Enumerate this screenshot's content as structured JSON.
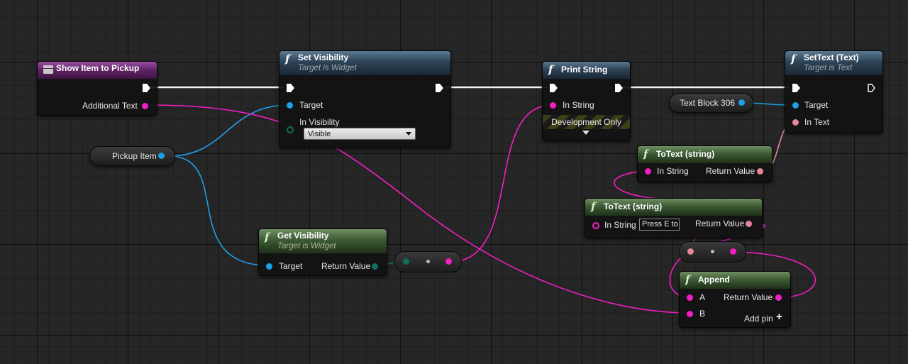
{
  "colors": {
    "exec": "#ffffff",
    "object_pin": "#1e9fe6",
    "string_pin": "#f21ec4",
    "text_pin": "#e6889c",
    "bool_pin": "#0f6f5e",
    "function_header": "#2e4356",
    "pure_header": "#3c5a34",
    "event_header": "#5e2262"
  },
  "nodes": {
    "show_item": {
      "title": "Show Item to Pickup",
      "icon": "event-icon",
      "pin_additional_text": "Additional Text"
    },
    "set_visibility": {
      "title": "Set Visibility",
      "subtitle": "Target is Widget",
      "pin_target": "Target",
      "pin_in_visibility": "In Visibility",
      "in_visibility_value": "Visible"
    },
    "print_string": {
      "title": "Print String",
      "pin_in_string": "In String",
      "dev_only": "Development Only"
    },
    "set_text": {
      "title": "SetText (Text)",
      "subtitle": "Target is Text",
      "pin_target": "Target",
      "pin_in_text": "In Text"
    },
    "pickup_item": {
      "label": "Pickup Item"
    },
    "text_block": {
      "label": "Text Block 306"
    },
    "get_visibility": {
      "title": "Get Visibility",
      "subtitle": "Target is Widget",
      "pin_target": "Target",
      "pin_return": "Return Value"
    },
    "totext_1": {
      "title": "ToText (string)",
      "pin_in_string": "In String",
      "pin_return": "Return Value"
    },
    "totext_2": {
      "title": "ToText (string)",
      "pin_in_string": "In String",
      "in_string_value": "Press E to",
      "pin_return": "Return Value"
    },
    "append": {
      "title": "Append",
      "pin_a": "A",
      "pin_b": "B",
      "pin_return": "Return Value",
      "add_pin": "Add pin"
    }
  }
}
